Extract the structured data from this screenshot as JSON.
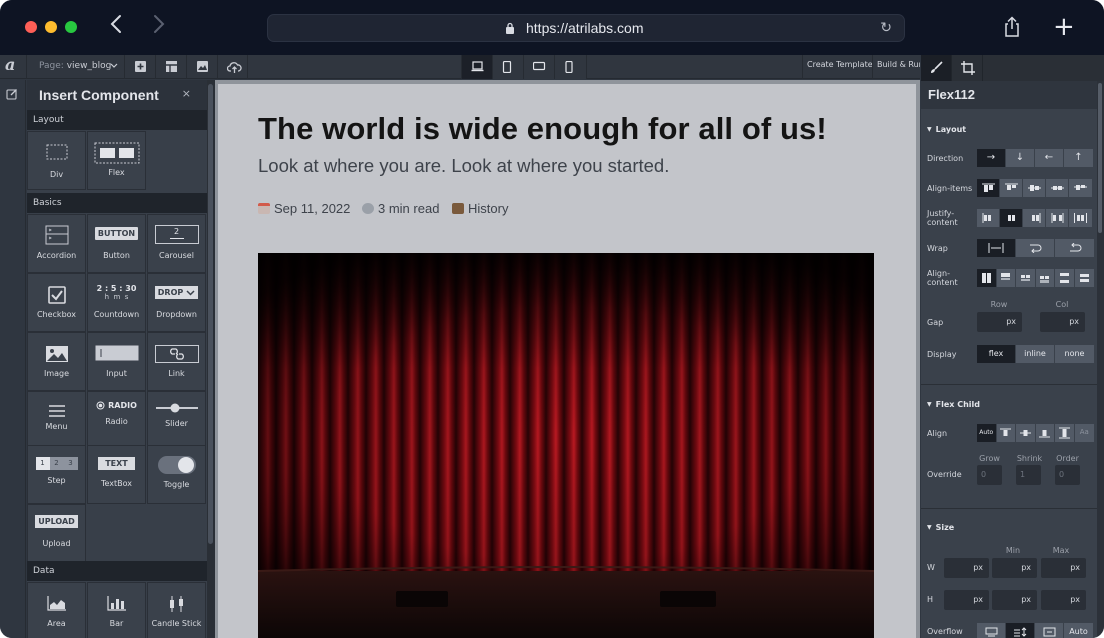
{
  "browser": {
    "url": "https://atrilabs.com"
  },
  "toolbar": {
    "page_prefix": "Page:",
    "page_name": "view_blog",
    "create_template": "Create Template",
    "build_run": "Build & Run"
  },
  "insert_panel": {
    "title": "Insert Component",
    "close": "×",
    "sections": {
      "layout": "Layout",
      "basics": "Basics",
      "data": "Data"
    },
    "components": {
      "div": "Div",
      "flex": "Flex",
      "accordion": "Accordion",
      "button": "Button",
      "carousel": "Carousel",
      "checkbox": "Checkbox",
      "countdown": "Countdown",
      "dropdown": "Dropdown",
      "image": "Image",
      "input": "Input",
      "link": "Link",
      "menu": "Menu",
      "radio": "Radio",
      "slider": "Slider",
      "step": "Step",
      "textbox": "TextBox",
      "toggle": "Toggle",
      "upload": "Upload",
      "area": "Area",
      "bar": "Bar",
      "candlestick": "Candle Stick"
    },
    "icon_text": {
      "button": "BUTTON",
      "carousel_num": "2",
      "countdown_time": "2 : 5 : 30",
      "countdown_units": "h  m  s",
      "dropdown": "DROP",
      "radio": "RADIO",
      "step_1": "1",
      "step_2": "2",
      "step_3": "3",
      "textbox": "TEXT",
      "upload": "UPLOAD"
    }
  },
  "canvas": {
    "title": "The world is wide enough for all of us!",
    "subtitle": "Look at where you are. Look at where you started.",
    "date": "Sep 11, 2022",
    "read_time": "3 min read",
    "category": "History"
  },
  "properties": {
    "component_name": "Flex112",
    "layout_section": "Layout",
    "direction_label": "Direction",
    "direction_options": [
      "→",
      "↓",
      "←",
      "↑"
    ],
    "align_items_label": "Align-items",
    "justify_content_label": "Justify-content",
    "wrap_label": "Wrap",
    "align_content_label": "Align-content",
    "gap_label": "Gap",
    "gap_row_label": "Row",
    "gap_col_label": "Col",
    "gap_row_value": "px",
    "gap_col_value": "px",
    "display_label": "Display",
    "display_options": [
      "flex",
      "inline",
      "none"
    ],
    "flex_child_section": "Flex Child",
    "align_label": "Align",
    "align_auto": "Auto",
    "override_label": "Override",
    "grow_label": "Grow",
    "shrink_label": "Shrink",
    "order_label": "Order",
    "grow_value": "0",
    "shrink_value": "1",
    "order_value": "0",
    "size_section": "Size",
    "min_label": "Min",
    "max_label": "Max",
    "w_label": "W",
    "h_label": "H",
    "px": "px",
    "overflow_label": "Overflow",
    "overflow_auto": "Auto"
  },
  "colors": {
    "titlebar": "#0e1423",
    "panel": "#383f49",
    "canvas": "#c3c5ca",
    "selected_button": "#1a1e25"
  }
}
